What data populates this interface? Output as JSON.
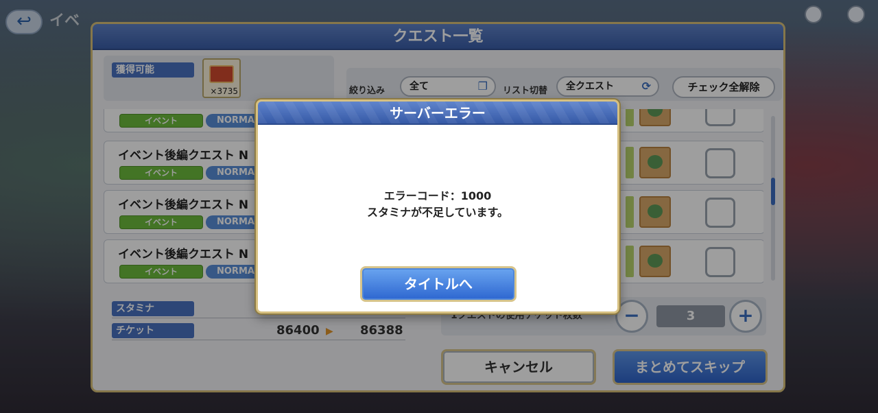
{
  "top": {
    "back_icon": "back-arrow-icon",
    "title_ghost": "イベ"
  },
  "panel": {
    "title": "クエスト一覧",
    "obtain_label": "獲得可能",
    "ticket_count": "×3735",
    "filter_label": "絞り込み",
    "filter_value": "全て",
    "list_toggle_label": "リスト切替",
    "list_toggle_value": "全クエスト",
    "clear_checks": "チェック全解除",
    "quests": [
      {
        "name": "",
        "tag": "イベント",
        "difficulty": "NORMA"
      },
      {
        "name": "イベント後編クエスト N",
        "tag": "イベント",
        "difficulty": "NORMA"
      },
      {
        "name": "イベント後編クエスト N",
        "tag": "イベント",
        "difficulty": "NORMA"
      },
      {
        "name": "イベント後編クエスト N",
        "tag": "イベント",
        "difficulty": "NORMA"
      }
    ],
    "stamina_label": "スタミナ",
    "ticket_label": "チケット",
    "ticket_before": "86400",
    "ticket_after": "86388",
    "count_label": "1クエストの使用チケット枚数",
    "count_value": "3",
    "minus": "−",
    "plus": "+",
    "cancel": "キャンセル",
    "skip_all": "まとめてスキップ"
  },
  "modal": {
    "title": "サーバーエラー",
    "error_code": "エラーコード：1000",
    "message": "スタミナが不足しています。",
    "button": "タイトルへ"
  }
}
